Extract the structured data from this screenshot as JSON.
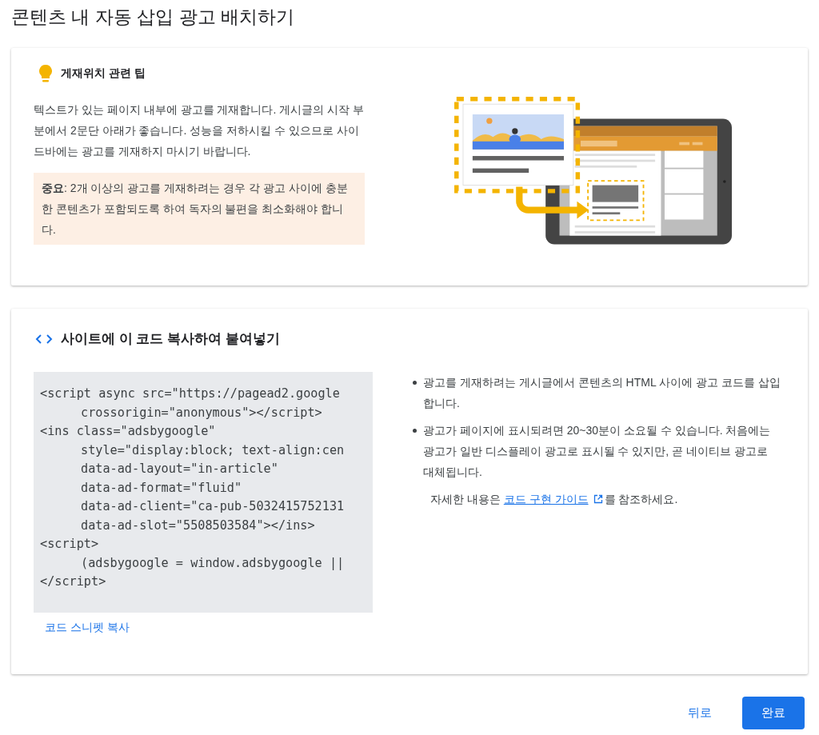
{
  "page_title": "콘텐츠 내 자동 삽입 광고 배치하기",
  "tip_card": {
    "heading": "게재위치 관련 팁",
    "body": "텍스트가 있는 페이지 내부에 광고를 게재합니다. 게시글의 시작 부분에서 2문단 아래가 좋습니다. 성능을 저하시킬 수 있으므로 사이드바에는 광고를 게재하지 마시기 바랍니다.",
    "notice": "**중요**: 2개 이상의 광고를 게재하려는 경우 각 광고 사이에 충분한 콘텐츠가 포함되도록 하여 독자의 불편을 최소화해야 합니다."
  },
  "code_card": {
    "heading": "사이트에 이 코드 복사하여 붙여넣기",
    "code_lines": [
      {
        "text": "<script async src=\"https://pagead2.google",
        "indented": false
      },
      {
        "text": "crossorigin=\"anonymous\"></script>",
        "indented": true
      },
      {
        "text": "<ins class=\"adsbygoogle\"",
        "indented": false
      },
      {
        "text": "style=\"display:block; text-align:cen",
        "indented": true
      },
      {
        "text": "data-ad-layout=\"in-article\"",
        "indented": true
      },
      {
        "text": "data-ad-format=\"fluid\"",
        "indented": true
      },
      {
        "text": "data-ad-client=\"ca-pub-5032415752131",
        "indented": true
      },
      {
        "text": "data-ad-slot=\"5508503584\"></ins>",
        "indented": true
      },
      {
        "text": "<script>",
        "indented": false
      },
      {
        "text": "(adsbygoogle = window.adsbygoogle ||",
        "indented": true
      },
      {
        "text": "</script>",
        "indented": false
      }
    ],
    "copy_link": "코드 스니펫 복사",
    "bullets": [
      "광고를 게재하려는 게시글에서 콘텐츠의 HTML 사이에 광고 코드를 삽입합니다.",
      "광고가 페이지에 표시되려면 20~30분이 소요될 수 있습니다. 처음에는 광고가 일반 디스플레이 광고로 표시될 수 있지만, 곧 네이티브 광고로 대체됩니다."
    ],
    "more_info": {
      "before": "자세한 내용은 ",
      "link": "코드 구현 가이드",
      "after": "를 참조하세요."
    }
  },
  "buttons": {
    "back": "뒤로",
    "done": "완료"
  }
}
